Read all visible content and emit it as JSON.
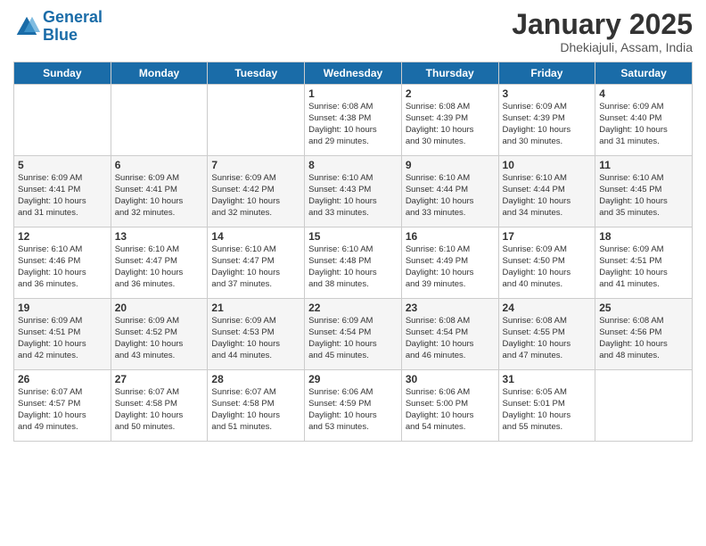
{
  "header": {
    "logo_line1": "General",
    "logo_line2": "Blue",
    "month": "January 2025",
    "location": "Dhekiajuli, Assam, India"
  },
  "days_of_week": [
    "Sunday",
    "Monday",
    "Tuesday",
    "Wednesday",
    "Thursday",
    "Friday",
    "Saturday"
  ],
  "weeks": [
    [
      {
        "day": "",
        "info": ""
      },
      {
        "day": "",
        "info": ""
      },
      {
        "day": "",
        "info": ""
      },
      {
        "day": "1",
        "info": "Sunrise: 6:08 AM\nSunset: 4:38 PM\nDaylight: 10 hours\nand 29 minutes."
      },
      {
        "day": "2",
        "info": "Sunrise: 6:08 AM\nSunset: 4:39 PM\nDaylight: 10 hours\nand 30 minutes."
      },
      {
        "day": "3",
        "info": "Sunrise: 6:09 AM\nSunset: 4:39 PM\nDaylight: 10 hours\nand 30 minutes."
      },
      {
        "day": "4",
        "info": "Sunrise: 6:09 AM\nSunset: 4:40 PM\nDaylight: 10 hours\nand 31 minutes."
      }
    ],
    [
      {
        "day": "5",
        "info": "Sunrise: 6:09 AM\nSunset: 4:41 PM\nDaylight: 10 hours\nand 31 minutes."
      },
      {
        "day": "6",
        "info": "Sunrise: 6:09 AM\nSunset: 4:41 PM\nDaylight: 10 hours\nand 32 minutes."
      },
      {
        "day": "7",
        "info": "Sunrise: 6:09 AM\nSunset: 4:42 PM\nDaylight: 10 hours\nand 32 minutes."
      },
      {
        "day": "8",
        "info": "Sunrise: 6:10 AM\nSunset: 4:43 PM\nDaylight: 10 hours\nand 33 minutes."
      },
      {
        "day": "9",
        "info": "Sunrise: 6:10 AM\nSunset: 4:44 PM\nDaylight: 10 hours\nand 33 minutes."
      },
      {
        "day": "10",
        "info": "Sunrise: 6:10 AM\nSunset: 4:44 PM\nDaylight: 10 hours\nand 34 minutes."
      },
      {
        "day": "11",
        "info": "Sunrise: 6:10 AM\nSunset: 4:45 PM\nDaylight: 10 hours\nand 35 minutes."
      }
    ],
    [
      {
        "day": "12",
        "info": "Sunrise: 6:10 AM\nSunset: 4:46 PM\nDaylight: 10 hours\nand 36 minutes."
      },
      {
        "day": "13",
        "info": "Sunrise: 6:10 AM\nSunset: 4:47 PM\nDaylight: 10 hours\nand 36 minutes."
      },
      {
        "day": "14",
        "info": "Sunrise: 6:10 AM\nSunset: 4:47 PM\nDaylight: 10 hours\nand 37 minutes."
      },
      {
        "day": "15",
        "info": "Sunrise: 6:10 AM\nSunset: 4:48 PM\nDaylight: 10 hours\nand 38 minutes."
      },
      {
        "day": "16",
        "info": "Sunrise: 6:10 AM\nSunset: 4:49 PM\nDaylight: 10 hours\nand 39 minutes."
      },
      {
        "day": "17",
        "info": "Sunrise: 6:09 AM\nSunset: 4:50 PM\nDaylight: 10 hours\nand 40 minutes."
      },
      {
        "day": "18",
        "info": "Sunrise: 6:09 AM\nSunset: 4:51 PM\nDaylight: 10 hours\nand 41 minutes."
      }
    ],
    [
      {
        "day": "19",
        "info": "Sunrise: 6:09 AM\nSunset: 4:51 PM\nDaylight: 10 hours\nand 42 minutes."
      },
      {
        "day": "20",
        "info": "Sunrise: 6:09 AM\nSunset: 4:52 PM\nDaylight: 10 hours\nand 43 minutes."
      },
      {
        "day": "21",
        "info": "Sunrise: 6:09 AM\nSunset: 4:53 PM\nDaylight: 10 hours\nand 44 minutes."
      },
      {
        "day": "22",
        "info": "Sunrise: 6:09 AM\nSunset: 4:54 PM\nDaylight: 10 hours\nand 45 minutes."
      },
      {
        "day": "23",
        "info": "Sunrise: 6:08 AM\nSunset: 4:54 PM\nDaylight: 10 hours\nand 46 minutes."
      },
      {
        "day": "24",
        "info": "Sunrise: 6:08 AM\nSunset: 4:55 PM\nDaylight: 10 hours\nand 47 minutes."
      },
      {
        "day": "25",
        "info": "Sunrise: 6:08 AM\nSunset: 4:56 PM\nDaylight: 10 hours\nand 48 minutes."
      }
    ],
    [
      {
        "day": "26",
        "info": "Sunrise: 6:07 AM\nSunset: 4:57 PM\nDaylight: 10 hours\nand 49 minutes."
      },
      {
        "day": "27",
        "info": "Sunrise: 6:07 AM\nSunset: 4:58 PM\nDaylight: 10 hours\nand 50 minutes."
      },
      {
        "day": "28",
        "info": "Sunrise: 6:07 AM\nSunset: 4:58 PM\nDaylight: 10 hours\nand 51 minutes."
      },
      {
        "day": "29",
        "info": "Sunrise: 6:06 AM\nSunset: 4:59 PM\nDaylight: 10 hours\nand 53 minutes."
      },
      {
        "day": "30",
        "info": "Sunrise: 6:06 AM\nSunset: 5:00 PM\nDaylight: 10 hours\nand 54 minutes."
      },
      {
        "day": "31",
        "info": "Sunrise: 6:05 AM\nSunset: 5:01 PM\nDaylight: 10 hours\nand 55 minutes."
      },
      {
        "day": "",
        "info": ""
      }
    ]
  ]
}
